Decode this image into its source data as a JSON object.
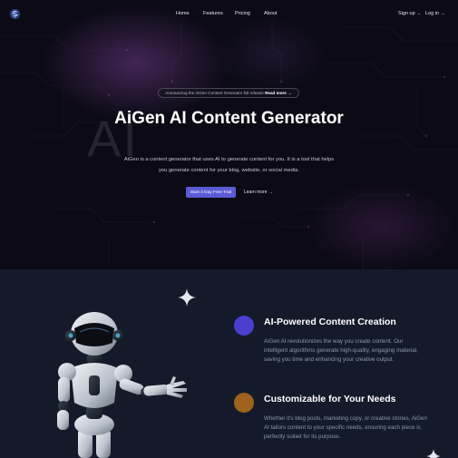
{
  "nav": {
    "links": [
      "Home",
      "Features",
      "Pricing",
      "About"
    ],
    "signup": "Sign up →",
    "login": "Log in →"
  },
  "hero": {
    "announcement": "Announcing the AiGen Content Generator full release",
    "announcement_link": "Read more →",
    "watermark": "AI",
    "title": "AiGen AI Content Generator",
    "subtitle": "AiGen is a content generator that uses AI to generate content for you. It is a tool that helps you generate content for your blog, website, or social media.",
    "cta_primary": "Start 3 Day Free Trial",
    "cta_secondary": "Learn more →"
  },
  "features": [
    {
      "title": "AI-Powered Content Creation",
      "text": "AiGen AI revolutionizes the way you create content. Our intelligent algorithms generate high-quality, engaging material, saving you time and enhancing your creative output.",
      "color": "#4b3fd0"
    },
    {
      "title": "Customizable for Your Needs",
      "text": "Whether it's blog posts, marketing copy, or creative stories, AiGen AI tailors content to your specific needs, ensuring each piece is perfectly suited for its purpose.",
      "color": "#a0621c"
    }
  ],
  "icons": {
    "logo": "brain-logo-icon",
    "sparkle": "sparkle-icon",
    "robot": "robot-illustration"
  },
  "colors": {
    "accent": "#5b5bd6",
    "hero_bg": "#0c0a14",
    "features_bg": "#141a29"
  }
}
